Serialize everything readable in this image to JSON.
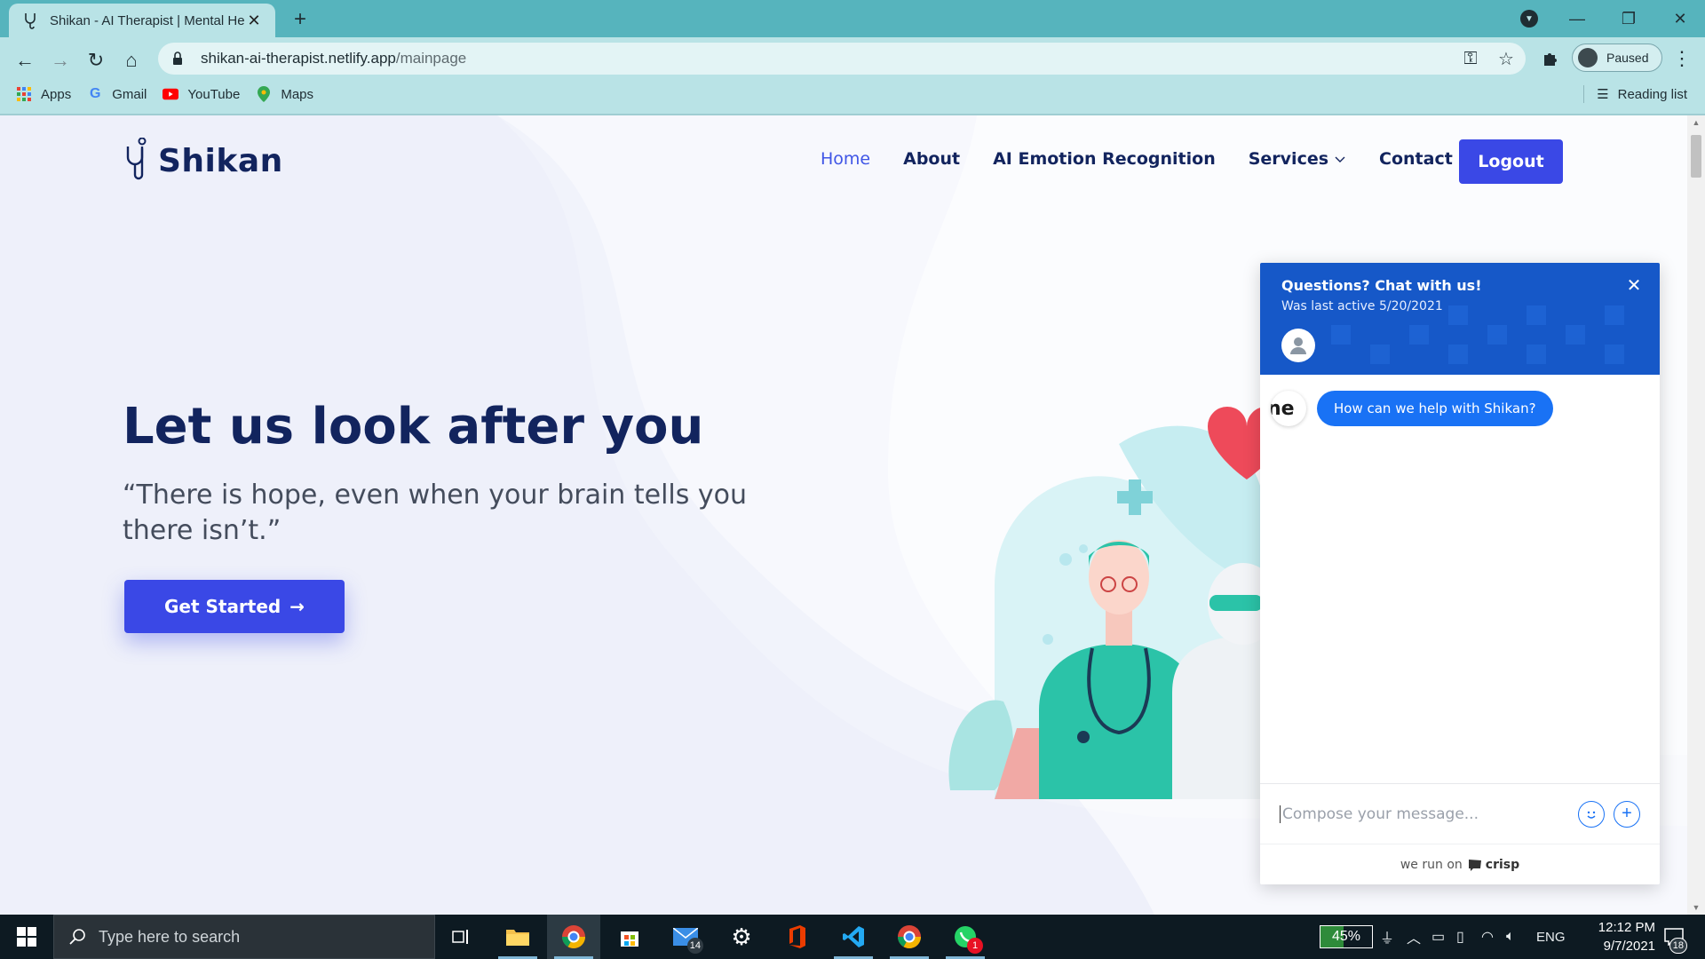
{
  "browser": {
    "tab_title": "Shikan - AI Therapist | Mental He",
    "url_domain": "shikan-ai-therapist.netlify.app",
    "url_path": "/mainpage",
    "profile_label": "Paused",
    "bookmarks": [
      {
        "label": "Apps",
        "icon": "apps-grid-icon"
      },
      {
        "label": "Gmail",
        "icon": "google-icon"
      },
      {
        "label": "YouTube",
        "icon": "youtube-icon"
      },
      {
        "label": "Maps",
        "icon": "maps-pin-icon"
      }
    ],
    "reading_list": "Reading list",
    "accent_color": "#56b4bd"
  },
  "site": {
    "logo_text": "Shikan",
    "nav": [
      {
        "label": "Home",
        "active": true
      },
      {
        "label": "About"
      },
      {
        "label": "AI Emotion Recognition"
      },
      {
        "label": "Services",
        "has_dropdown": true
      },
      {
        "label": "Contact Us"
      }
    ],
    "logout_label": "Logout",
    "hero_title": "Let us look after you",
    "hero_quote": "“There is hope, even when your brain tells you there isn’t.”",
    "cta_label": "Get Started",
    "brand_color": "#3a48e6",
    "heading_color": "#12245e"
  },
  "chat": {
    "title": "Questions? Chat with us!",
    "subtitle": "Was last active 5/20/2021",
    "avatar_text": "ne",
    "message": "How can we help with Shikan?",
    "compose_placeholder": "Compose your message...",
    "footer_prefix": "we run on",
    "footer_brand": "crisp",
    "header_color": "#1658c8",
    "bubble_color": "#1972f5"
  },
  "taskbar": {
    "search_placeholder": "Type here to search",
    "mail_badge": "14",
    "whatsapp_badge": "1",
    "battery_percent": "45%",
    "language": "ENG",
    "time": "12:12 PM",
    "date": "9/7/2021",
    "notifications": "18"
  }
}
